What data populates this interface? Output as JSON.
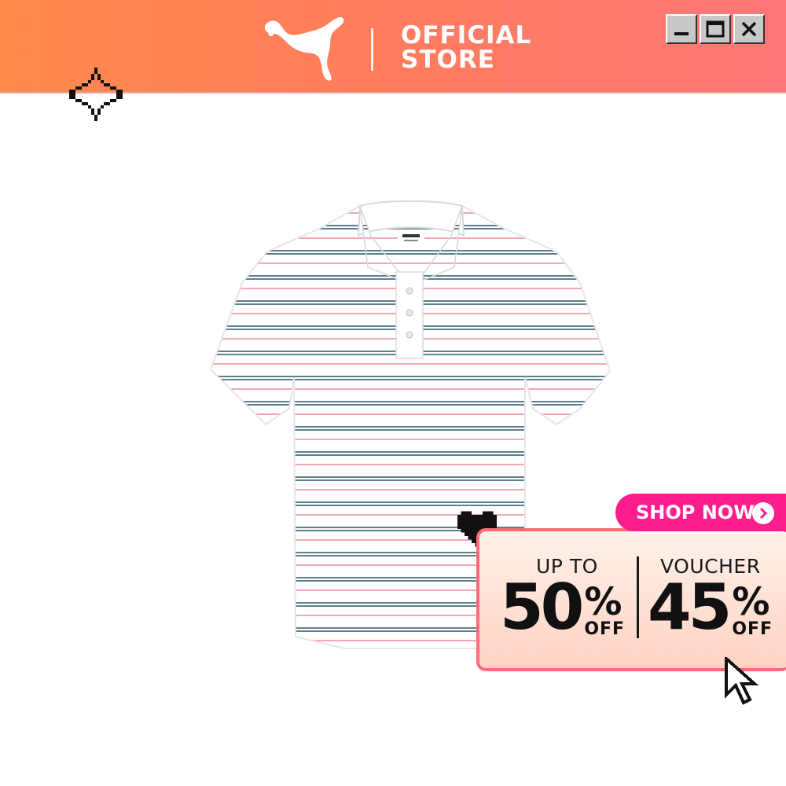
{
  "header": {
    "brand_line1": "OFFICIAL",
    "brand_line2": "STORE",
    "logo_icon": "puma-cat-logo",
    "colors": {
      "gradient_start": "#ff8a4c",
      "gradient_end": "#ff7677"
    }
  },
  "window_controls": [
    "minimize-icon",
    "maximize-icon",
    "close-icon"
  ],
  "product": {
    "image": "striped-polo-shirt"
  },
  "promo": {
    "shop_now_label": "SHOP NOW",
    "left": {
      "heading": "UP TO",
      "value": "50",
      "percent": "%",
      "suffix": "OFF"
    },
    "right": {
      "heading": "VOUCHER",
      "value": "45",
      "percent": "%",
      "suffix": "OFF"
    },
    "colors": {
      "accent": "#ff1c8d",
      "border": "#ff6b7a"
    }
  },
  "decor": [
    "sparkle-icon",
    "heart-icon",
    "cursor-icon"
  ]
}
